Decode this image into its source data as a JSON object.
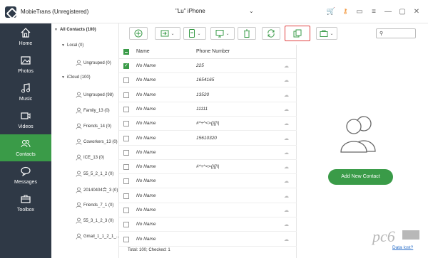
{
  "app": {
    "title": "MobieTrans (Unregistered)",
    "device_name": "\"Lu\" iPhone"
  },
  "sidebar": {
    "items": [
      {
        "label": "Home",
        "icon": "home-icon",
        "active": false
      },
      {
        "label": "Photos",
        "icon": "photos-icon",
        "active": false
      },
      {
        "label": "Music",
        "icon": "music-icon",
        "active": false
      },
      {
        "label": "Videos",
        "icon": "video-icon",
        "active": false
      },
      {
        "label": "Contacts",
        "icon": "contacts-icon",
        "active": true
      },
      {
        "label": "Messages",
        "icon": "messages-icon",
        "active": false
      },
      {
        "label": "Toolbox",
        "icon": "toolbox-icon",
        "active": false
      }
    ]
  },
  "tree": {
    "all_contacts": "All Contacts  (100)",
    "local": "Local  (0)",
    "local_ungrouped": "Ungrouped  (0)",
    "icloud": "iCloud  (100)",
    "groups": [
      "Ungrouped  (98)",
      "Family_13  (0)",
      "Friends_14  (0)",
      "Coworkers_13  (0)",
      "ICE_13  (0)",
      "55_5_2_1_2  (0)",
      "20140404合_3  (0)",
      "Friends_7_1  (0)",
      "55_3_1_2_3  (0)",
      "Gmail_1_1_2_1_...  (0)"
    ]
  },
  "grid": {
    "headers": {
      "name": "Name",
      "phone": "Phone Number"
    },
    "rows": [
      {
        "name": "No Name",
        "phone": "225",
        "checked": true
      },
      {
        "name": "No Name",
        "phone": "1654165",
        "checked": false
      },
      {
        "name": "No Name",
        "phone": "13520",
        "checked": false
      },
      {
        "name": "No Name",
        "phone": "11111",
        "checked": false
      },
      {
        "name": "No Name",
        "phone": "#*+^<>{}[]\\|",
        "checked": false
      },
      {
        "name": "No Name",
        "phone": "15610320",
        "checked": false
      },
      {
        "name": "No Name",
        "phone": "",
        "checked": false
      },
      {
        "name": "No Name",
        "phone": "#*+^<>{}[]\\|",
        "checked": false
      },
      {
        "name": "No Name",
        "phone": "",
        "checked": false
      },
      {
        "name": "No Name",
        "phone": "",
        "checked": false
      },
      {
        "name": "No Name",
        "phone": "",
        "checked": false
      },
      {
        "name": "No Name",
        "phone": "",
        "checked": false
      },
      {
        "name": "No Name",
        "phone": "",
        "checked": false
      }
    ],
    "status": "Total: 100; Checked: 1"
  },
  "detail": {
    "add_button": "Add New Contact"
  },
  "footer": {
    "data_lost": "Data lost?"
  },
  "colors": {
    "accent": "#3a9b48",
    "sidebar": "#2f3946",
    "highlight": "#e04040"
  }
}
